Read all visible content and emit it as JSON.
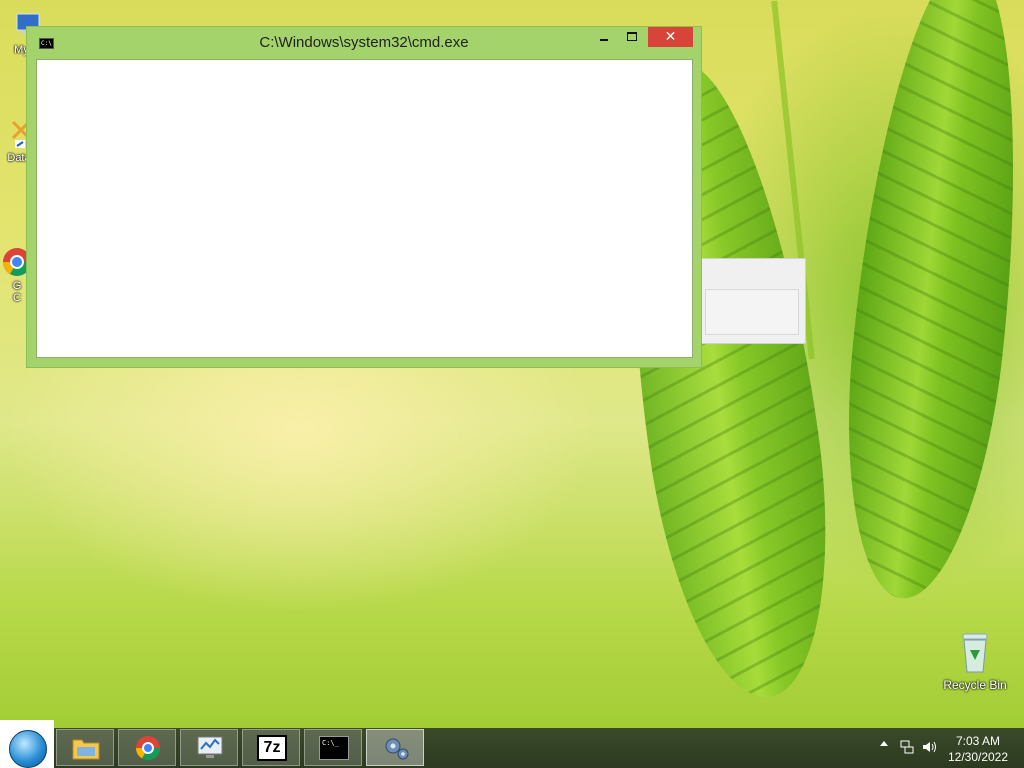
{
  "desktop": {
    "icons": [
      {
        "label": "My C"
      },
      {
        "label": "Data"
      },
      {
        "label": "G\nC"
      }
    ],
    "recycle_bin": {
      "label": "Recycle Bin"
    }
  },
  "window": {
    "title": "C:\\Windows\\system32\\cmd.exe",
    "icon_text": "C:\\",
    "close_glyph": "✕"
  },
  "taskbar": {
    "buttons": [
      {
        "name": "file-explorer",
        "icon": "folder-icon"
      },
      {
        "name": "chrome",
        "icon": "chrome-icon"
      },
      {
        "name": "system-monitor",
        "icon": "monitor-icon"
      },
      {
        "name": "7zip",
        "icon": "7zip-icon",
        "text": "7z"
      },
      {
        "name": "cmd",
        "icon": "cmd-icon",
        "text": "C:\\_"
      },
      {
        "name": "settings",
        "icon": "gear-icon",
        "active": true
      }
    ],
    "tray": {
      "time": "7:03 AM",
      "date": "12/30/2022"
    }
  },
  "colors": {
    "window_frame": "#a3d36a",
    "close_button": "#d9443a",
    "taskbar": "#2d3a20"
  }
}
